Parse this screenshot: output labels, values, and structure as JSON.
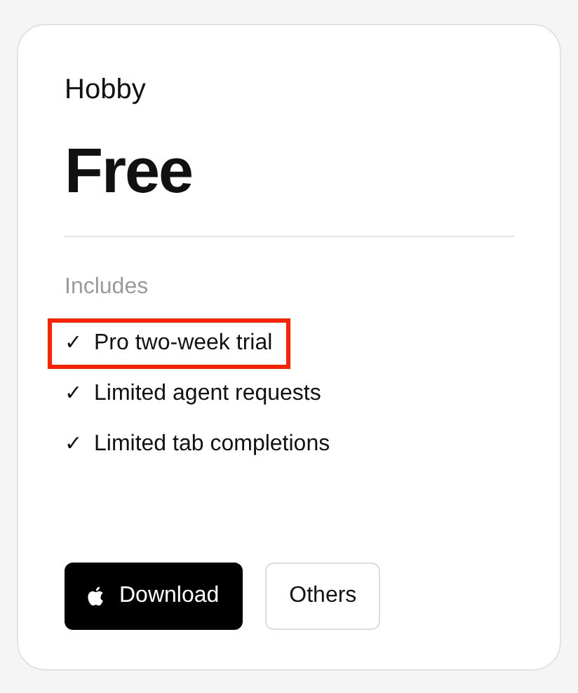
{
  "plan": {
    "name": "Hobby",
    "price": "Free"
  },
  "includes": {
    "heading": "Includes",
    "features": [
      {
        "mark": "✓",
        "text": "Pro two-week trial",
        "highlighted": true
      },
      {
        "mark": "✓",
        "text": "Limited agent requests",
        "highlighted": false
      },
      {
        "mark": "✓",
        "text": "Limited tab completions",
        "highlighted": false
      }
    ]
  },
  "buttons": [
    {
      "kind": "primary",
      "label": "Download"
    },
    {
      "kind": "secondary",
      "label": "Others"
    }
  ]
}
